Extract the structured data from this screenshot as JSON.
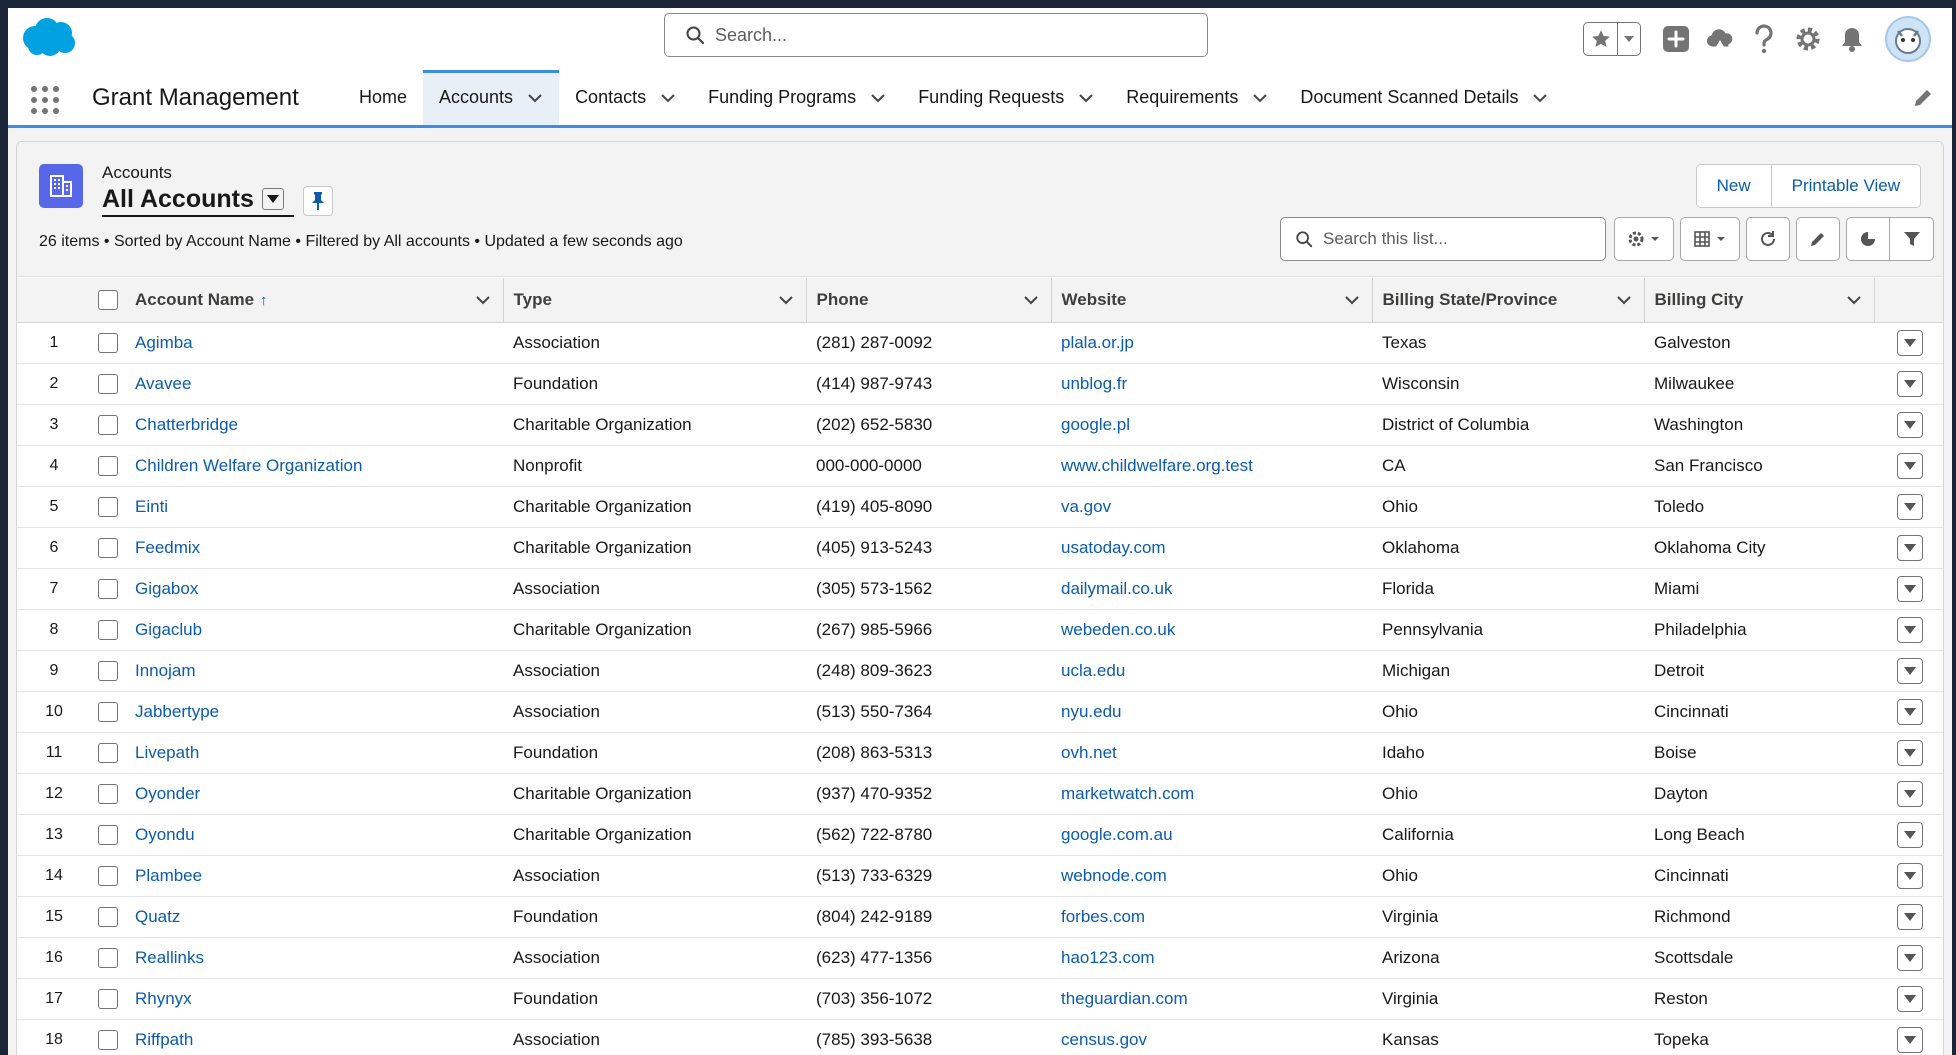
{
  "header": {
    "search_placeholder": "Search..."
  },
  "nav": {
    "app_name": "Grant Management",
    "tabs": [
      {
        "label": "Home",
        "has_menu": false
      },
      {
        "label": "Accounts",
        "has_menu": true,
        "active": true
      },
      {
        "label": "Contacts",
        "has_menu": true
      },
      {
        "label": "Funding Programs",
        "has_menu": true
      },
      {
        "label": "Funding Requests",
        "has_menu": true
      },
      {
        "label": "Requirements",
        "has_menu": true
      },
      {
        "label": "Document Scanned Details",
        "has_menu": true
      }
    ]
  },
  "list_view": {
    "object_label": "Accounts",
    "view_name": "All Accounts",
    "meta": "26 items • Sorted by Account Name • Filtered by All accounts • Updated a few seconds ago",
    "buttons": {
      "new": "New",
      "printable": "Printable View"
    },
    "search_placeholder": "Search this list...",
    "columns": [
      "Account Name",
      "Type",
      "Phone",
      "Website",
      "Billing State/Province",
      "Billing City"
    ],
    "rows": [
      [
        "1",
        "Agimba",
        "Association",
        "(281) 287-0092",
        "plala.or.jp",
        "Texas",
        "Galveston"
      ],
      [
        "2",
        "Avavee",
        "Foundation",
        "(414) 987-9743",
        "unblog.fr",
        "Wisconsin",
        "Milwaukee"
      ],
      [
        "3",
        "Chatterbridge",
        "Charitable Organization",
        "(202) 652-5830",
        "google.pl",
        "District of Columbia",
        "Washington"
      ],
      [
        "4",
        "Children Welfare Organization",
        "Nonprofit",
        "000-000-0000",
        "www.childwelfare.org.test",
        "CA",
        "San Francisco"
      ],
      [
        "5",
        "Einti",
        "Charitable Organization",
        "(419) 405-8090",
        "va.gov",
        "Ohio",
        "Toledo"
      ],
      [
        "6",
        "Feedmix",
        "Charitable Organization",
        "(405) 913-5243",
        "usatoday.com",
        "Oklahoma",
        "Oklahoma City"
      ],
      [
        "7",
        "Gigabox",
        "Association",
        "(305) 573-1562",
        "dailymail.co.uk",
        "Florida",
        "Miami"
      ],
      [
        "8",
        "Gigaclub",
        "Charitable Organization",
        "(267) 985-5966",
        "webeden.co.uk",
        "Pennsylvania",
        "Philadelphia"
      ],
      [
        "9",
        "Innojam",
        "Association",
        "(248) 809-3623",
        "ucla.edu",
        "Michigan",
        "Detroit"
      ],
      [
        "10",
        "Jabbertype",
        "Association",
        "(513) 550-7364",
        "nyu.edu",
        "Ohio",
        "Cincinnati"
      ],
      [
        "11",
        "Livepath",
        "Foundation",
        "(208) 863-5313",
        "ovh.net",
        "Idaho",
        "Boise"
      ],
      [
        "12",
        "Oyonder",
        "Charitable Organization",
        "(937) 470-9352",
        "marketwatch.com",
        "Ohio",
        "Dayton"
      ],
      [
        "13",
        "Oyondu",
        "Charitable Organization",
        "(562) 722-8780",
        "google.com.au",
        "California",
        "Long Beach"
      ],
      [
        "14",
        "Plambee",
        "Association",
        "(513) 733-6329",
        "webnode.com",
        "Ohio",
        "Cincinnati"
      ],
      [
        "15",
        "Quatz",
        "Foundation",
        "(804) 242-9189",
        "forbes.com",
        "Virginia",
        "Richmond"
      ],
      [
        "16",
        "Reallinks",
        "Association",
        "(623) 477-1356",
        "hao123.com",
        "Arizona",
        "Scottsdale"
      ],
      [
        "17",
        "Rhynyx",
        "Foundation",
        "(703) 356-1072",
        "theguardian.com",
        "Virginia",
        "Reston"
      ],
      [
        "18",
        "Riffpath",
        "Association",
        "(785) 393-5638",
        "census.gov",
        "Kansas",
        "Topeka"
      ]
    ]
  },
  "colors": {
    "brand_blue": "#00a1e0",
    "link": "#0b5cab",
    "accent": "#3a8ee8",
    "object_icon": "#5867e8"
  }
}
